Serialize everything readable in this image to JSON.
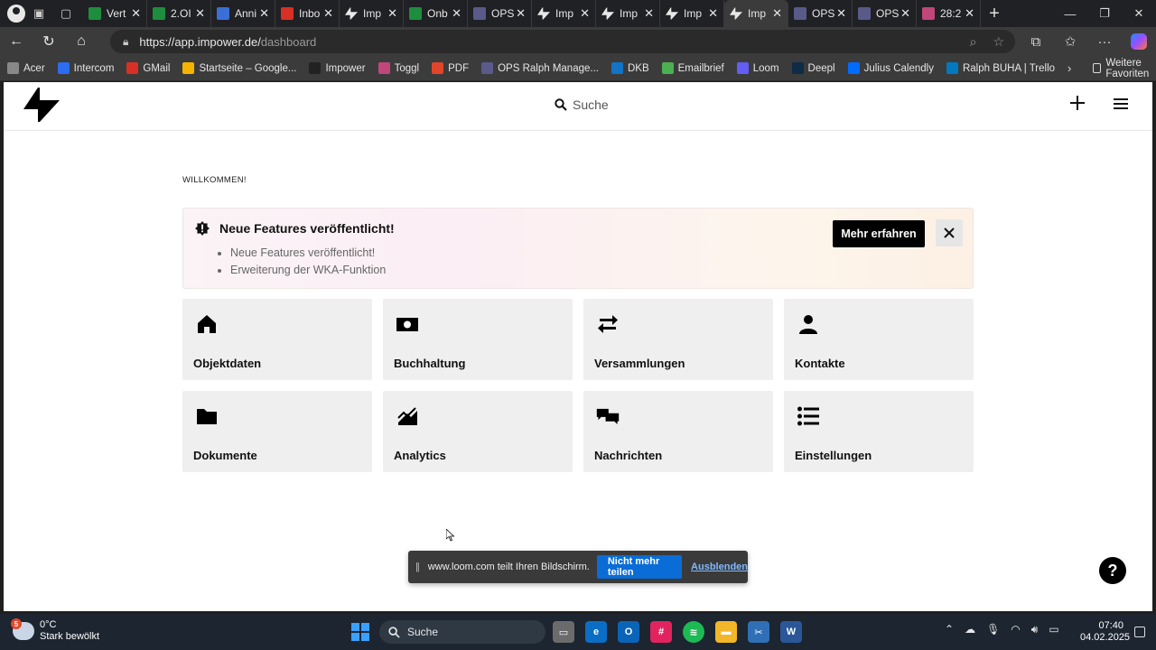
{
  "browser": {
    "tabs": [
      {
        "label": "Vert",
        "fav": "sheet",
        "color": "#1e8e3e"
      },
      {
        "label": "2.OI",
        "fav": "sheet",
        "color": "#1e8e3e"
      },
      {
        "label": "Anni",
        "fav": "grid",
        "color": "#3b6fd8"
      },
      {
        "label": "Inbo",
        "fav": "gmail",
        "color": "#d93025"
      },
      {
        "label": "Imp",
        "fav": "impower",
        "color": "#111111"
      },
      {
        "label": "Onb",
        "fav": "sheet",
        "color": "#1e8e3e"
      },
      {
        "label": "OPS",
        "fav": "ops",
        "color": "#5a5a8a"
      },
      {
        "label": "Imp",
        "fav": "impower",
        "color": "#111111"
      },
      {
        "label": "Imp",
        "fav": "impower",
        "color": "#111111"
      },
      {
        "label": "Imp",
        "fav": "impower",
        "color": "#111111"
      },
      {
        "label": "Imp",
        "fav": "impower",
        "color": "#111111",
        "active": true
      },
      {
        "label": "OPS",
        "fav": "ops",
        "color": "#5a5a8a"
      },
      {
        "label": "OPS",
        "fav": "ops",
        "color": "#5a5a8a"
      },
      {
        "label": "28:2",
        "fav": "toggl",
        "color": "#c1467a"
      }
    ],
    "url_prefix": "https://app.impower.de/",
    "url_path": "dashboard",
    "bookmarks": [
      {
        "label": "Acer",
        "color": "#888888"
      },
      {
        "label": "Intercom",
        "color": "#2b6cf0"
      },
      {
        "label": "GMail",
        "color": "#d93025"
      },
      {
        "label": "Startseite – Google...",
        "color": "#f4b400"
      },
      {
        "label": "Impower",
        "color": "#222222"
      },
      {
        "label": "Toggl",
        "color": "#c1467a"
      },
      {
        "label": "PDF",
        "color": "#e0452b"
      },
      {
        "label": "OPS Ralph Manage...",
        "color": "#5a5a8a"
      },
      {
        "label": "DKB",
        "color": "#1273c7"
      },
      {
        "label": "Emailbrief",
        "color": "#4caf50"
      },
      {
        "label": "Loom",
        "color": "#625df5"
      },
      {
        "label": "Deepl",
        "color": "#0f2b46"
      },
      {
        "label": "Julius Calendly",
        "color": "#006bff"
      },
      {
        "label": "Ralph BUHA | Trello",
        "color": "#0079bf"
      }
    ],
    "bookmarks_folder": "Weitere Favoriten"
  },
  "app": {
    "search_label": "Suche",
    "welcome": "WILLKOMMEN!",
    "banner": {
      "title": "Neue Features veröffentlicht!",
      "items": [
        "Neue Features veröffentlicht!",
        "Erweiterung der WKA-Funktion"
      ],
      "more_label": "Mehr erfahren"
    },
    "tiles": [
      {
        "label": "Objektdaten",
        "icon": "house-icon"
      },
      {
        "label": "Buchhaltung",
        "icon": "money-icon"
      },
      {
        "label": "Versammlungen",
        "icon": "swap-arrows-icon"
      },
      {
        "label": "Kontakte",
        "icon": "person-icon"
      },
      {
        "label": "Dokumente",
        "icon": "folder-icon"
      },
      {
        "label": "Analytics",
        "icon": "chart-icon"
      },
      {
        "label": "Nachrichten",
        "icon": "chat-bubbles-icon"
      },
      {
        "label": "Einstellungen",
        "icon": "list-icon"
      }
    ]
  },
  "share_bar": {
    "text": "www.loom.com teilt Ihren Bildschirm.",
    "stop_label": "Nicht mehr teilen",
    "hide_label": "Ausblenden"
  },
  "help_label": "?",
  "taskbar": {
    "weather_badge": "5",
    "temperature": "0°C",
    "weather_desc": "Stark bewölkt",
    "search_label": "Suche",
    "time": "07:40",
    "date": "04.02.2025"
  }
}
